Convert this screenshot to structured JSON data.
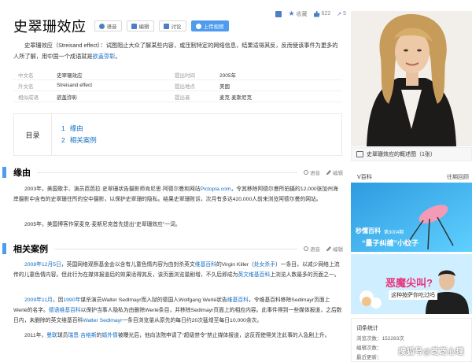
{
  "header": {
    "title": "史翠珊效应",
    "buttons": {
      "voice": "语音",
      "edit": "编辑",
      "discuss": "讨论",
      "upload": "上传视频"
    },
    "actions": {
      "collect": "收藏",
      "likes": "622",
      "shares": "5"
    }
  },
  "summary": {
    "text_before": "史翠珊效应（Streisand effect）：试图阻止大众了解某些内容，或压制特定的网络信息，结果适得其反，反而使该事件为更多的人所了解，用中国一个成语就是",
    "link": "欲盖弥彰",
    "text_after": "。"
  },
  "info_table": [
    {
      "k": "中文名",
      "v": "史翠珊效应",
      "k2": "提出时间",
      "v2": "2005年"
    },
    {
      "k": "外文名",
      "v": "Streisand effect",
      "k2": "提出地点",
      "v2": "美国"
    },
    {
      "k": "相似成语",
      "v": "欲盖弥彰",
      "k2": "提出者",
      "v2": "麦克·麦斯尼克"
    }
  ],
  "toc": {
    "label": "目录",
    "items": [
      {
        "num": "1",
        "label": "缘由"
      },
      {
        "num": "2",
        "label": "相关案例"
      }
    ]
  },
  "sections": {
    "origin": {
      "title": "缘由",
      "voice": "语音",
      "edit": "编辑",
      "p1_before": "2003年，美国歌手、演员芭芭拉·史翠珊状告摄影师肯尼思·阿德尔曼和网站",
      "p1_link": "Pictopia.com",
      "p1_after": "，令其移除阿德尔曼所拍摄的12,000张加州海岸摄影中含有的史翠珊住所的空中摄影，以保护史翠珊的隐私。结果史翠珊败诉，次月有多达420,000人前来浏览阿德尔曼的网站。",
      "p2": "2005年，美国博客作家麦克·麦斯尼克首先提出“史翠珊效应”一词。"
    },
    "cases": {
      "title": "相关案例",
      "voice": "语音",
      "edit": "编辑",
      "p1_date": "2008年12月5日",
      "p1_a": "，英国网络观察基金会以含有儿童色情内容为由封杀英文",
      "p1_link1": "维基百科",
      "p1_b": "的Virgin Killer（",
      "p1_link2": "处女杀手",
      "p1_c": "）一条目，以减少网络上流传的儿童色情内容。但此行为在媒体报道后的效果适得其反，该页面浏览量剧增，不久后即成为",
      "p1_link3": "英文维基百科",
      "p1_d": "上浏览人数最多的页面之一。",
      "p2_date": "2009年11月",
      "p2_a": "，因",
      "p2_link1": "1990年",
      "p2_b": "谋杀演员Walter Sedlmayr而入狱的德国人Wolfgang Werlé状告",
      "p2_link2": "维基百科",
      "p2_c": "，令维基百科移除Sedlmayr页面上Werlé的名字。",
      "p2_link3": "德语维基百科",
      "p2_d": "以保护当事人隐私为由删除Werlé条目，并移除Sedlmayr页面上的相应内容。此事件得到一些媒体报道，之后数日内，未删除的英文维基百科",
      "p2_link4": "Walter Sedlmayr",
      "p2_e": "一条目浏览量从原先的每日约20次猛增至每日10,000余次。",
      "p3_a": "2011年，",
      "p3_link1": "曼联",
      "p3_b": "球员",
      "p3_link2": "瑞恩·吉格斯",
      "p3_c": "的",
      "p3_link3": "婚外情",
      "p3_d": "被曝光后，他向法院申请了“超级禁令”禁止媒体报道，这反而使得关注此事的人急剧上升。"
    }
  },
  "sidebar": {
    "caption": "史翠珊效应的概述图（1张）",
    "vbaike": {
      "label": "V百科",
      "more": "往期回顾"
    },
    "card1": {
      "brand": "秒懂百科",
      "sub": "第3004期",
      "title": "“量子纠缠”小蚊子"
    },
    "card2": {
      "headline": "恶魔尖叫?",
      "sub": "这种按萨你吃过吗"
    },
    "stats": {
      "title": "词条统计",
      "views_label": "浏览次数：",
      "views": "152283次",
      "edits_label": "编辑次数：",
      "updated_label": "最近更新："
    }
  },
  "watermark": "搜狐号@芝芝心理",
  "colors": {
    "link": "#136ec2",
    "accent": "#4f9cee",
    "title": "#000000"
  }
}
